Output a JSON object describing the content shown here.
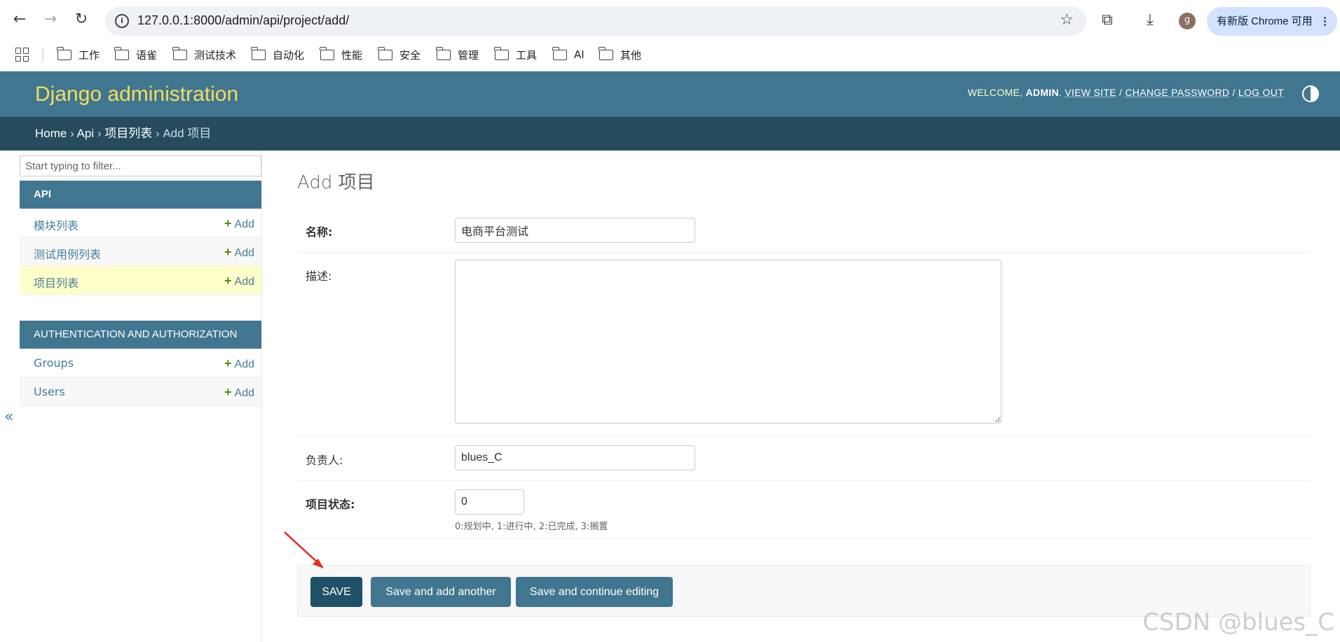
{
  "browser": {
    "url": "127.0.0.1:8000/admin/api/project/add/",
    "update_label": "有新版 Chrome 可用",
    "avatar_letter": "g",
    "bookmarks": [
      "工作",
      "语雀",
      "测试技术",
      "自动化",
      "性能",
      "安全",
      "管理",
      "工具",
      "AI",
      "其他"
    ]
  },
  "header": {
    "site_name": "Django administration",
    "welcome": "WELCOME, ",
    "username": "ADMIN",
    "view_site": "VIEW SITE",
    "change_password": "CHANGE PASSWORD",
    "log_out": "LOG OUT",
    "sep": " / "
  },
  "breadcrumbs": {
    "home": "Home",
    "app": "Api",
    "model": "项目列表",
    "current": "Add 项目",
    "sep": " › "
  },
  "sidebar": {
    "filter_placeholder": "Start typing to filter...",
    "modules": [
      {
        "caption": "API",
        "items": [
          {
            "name": "模块列表",
            "add": "Add"
          },
          {
            "name": "测试用例列表",
            "add": "Add"
          },
          {
            "name": "项目列表",
            "add": "Add"
          }
        ]
      },
      {
        "caption": "AUTHENTICATION AND AUTHORIZATION",
        "items": [
          {
            "name": "Groups",
            "add": "Add"
          },
          {
            "name": "Users",
            "add": "Add"
          }
        ]
      }
    ],
    "collapse": "«"
  },
  "content": {
    "title": "Add 项目",
    "fields": {
      "name": {
        "label": "名称:",
        "value": "电商平台测试"
      },
      "description": {
        "label": "描述:",
        "value": ""
      },
      "owner": {
        "label": "负责人:",
        "value": "blues_C"
      },
      "status": {
        "label": "项目状态:",
        "value": "0",
        "help": "0:规划中, 1:进行中, 2:已完成, 3:搁置"
      }
    },
    "buttons": {
      "save": "SAVE",
      "save_add_another": "Save and add another",
      "save_continue": "Save and continue editing"
    }
  },
  "watermark": "CSDN @blues_C",
  "colors": {
    "header": "#417690",
    "breadcrumbs": "#264b5d",
    "brand": "#f5dd5d",
    "link": "#447e9b",
    "add_plus": "#5b8c00",
    "selected_row": "#ffffcc",
    "save_button": "#205067",
    "arrow": "#e8281e"
  }
}
